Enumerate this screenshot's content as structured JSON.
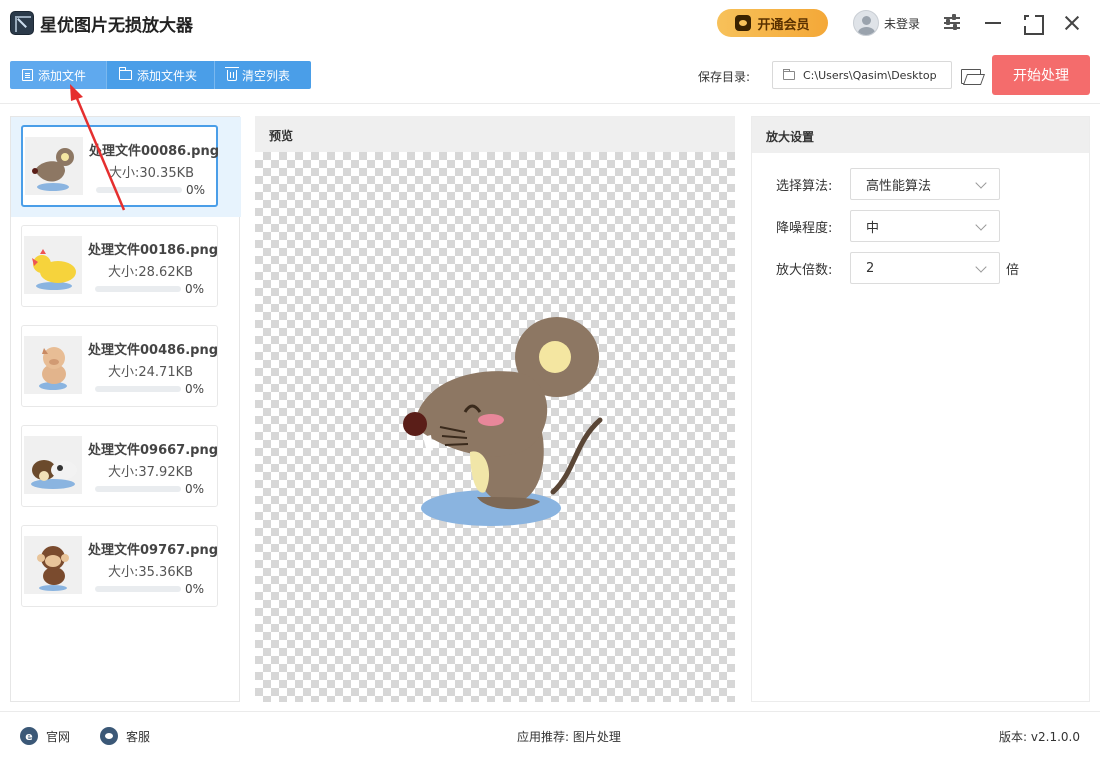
{
  "app": {
    "title": "星优图片无损放大器"
  },
  "header": {
    "vip_label": "开通会员",
    "user_label": "未登录"
  },
  "toolbar": {
    "add_file": "添加文件",
    "add_folder": "添加文件夹",
    "clear_list": "清空列表",
    "save_dir_label": "保存目录:",
    "save_dir_value": "C:\\Users\\Qasim\\Desktop",
    "start_label": "开始处理"
  },
  "files": [
    {
      "name": "处理文件00086.png",
      "size": "大小:30.35KB",
      "percent": "0%",
      "progress": 0,
      "thumb": "mouse",
      "active": true
    },
    {
      "name": "处理文件00186.png",
      "size": "大小:28.62KB",
      "percent": "0%",
      "progress": 0,
      "thumb": "chicken",
      "active": false
    },
    {
      "name": "处理文件00486.png",
      "size": "大小:24.71KB",
      "percent": "0%",
      "progress": 0,
      "thumb": "pig",
      "active": false
    },
    {
      "name": "处理文件09667.png",
      "size": "大小:37.92KB",
      "percent": "0%",
      "progress": 0,
      "thumb": "cows",
      "active": false
    },
    {
      "name": "处理文件09767.png",
      "size": "大小:35.36KB",
      "percent": "0%",
      "progress": 0,
      "thumb": "monkey",
      "active": false
    }
  ],
  "preview": {
    "title": "预览"
  },
  "settings": {
    "title": "放大设置",
    "algorithm_label": "选择算法:",
    "algorithm_value": "高性能算法",
    "denoise_label": "降噪程度:",
    "denoise_value": "中",
    "scale_label": "放大倍数:",
    "scale_value": "2",
    "scale_suffix": "倍"
  },
  "footer": {
    "website": "官网",
    "support": "客服",
    "recommend": "应用推荐:  图片处理",
    "version": "版本:  v2.1.0.0"
  },
  "colors": {
    "accent": "#4a9ee8",
    "start": "#f46c6c",
    "vip": "#f4a838",
    "arrow": "#e52f2f"
  }
}
